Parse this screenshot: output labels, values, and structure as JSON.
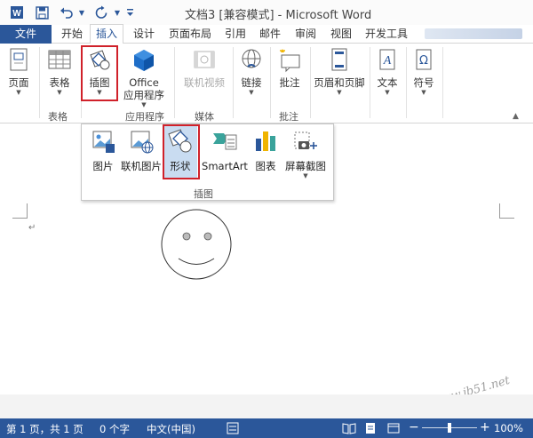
{
  "window": {
    "title": "文档3 [兼容模式] - Microsoft Word"
  },
  "tabs": [
    {
      "label": "文件"
    },
    {
      "label": "开始"
    },
    {
      "label": "插入"
    },
    {
      "label": "设计"
    },
    {
      "label": "页面布局"
    },
    {
      "label": "引用"
    },
    {
      "label": "邮件"
    },
    {
      "label": "审阅"
    },
    {
      "label": "视图"
    },
    {
      "label": "开发工具"
    }
  ],
  "ribbon": {
    "page": "页面",
    "table": "表格",
    "illustrations": "插图",
    "office": "Office",
    "apps": "应用程序",
    "online_video": "联机视频",
    "links": "链接",
    "comment": "批注",
    "header_footer": "页眉和页脚",
    "text": "文本",
    "symbol": "符号",
    "groups": {
      "table": "表格",
      "apps": "应用程序",
      "media": "媒体",
      "comments": "批注"
    }
  },
  "popup": {
    "picture": "图片",
    "online_picture": "联机图片",
    "shapes": "形状",
    "smartart": "SmartArt",
    "chart": "图表",
    "screenshot": "屏幕截图",
    "group_label": "插图"
  },
  "status": {
    "page": "第 1 页，共 1 页",
    "words": "0 个字",
    "language": "中文(中国)",
    "zoom": "100%",
    "zoom_level": 0.5
  },
  "watermark": "www.jb51.net",
  "colors": {
    "accent": "#2b579a",
    "highlight_box": "#d0212a"
  }
}
